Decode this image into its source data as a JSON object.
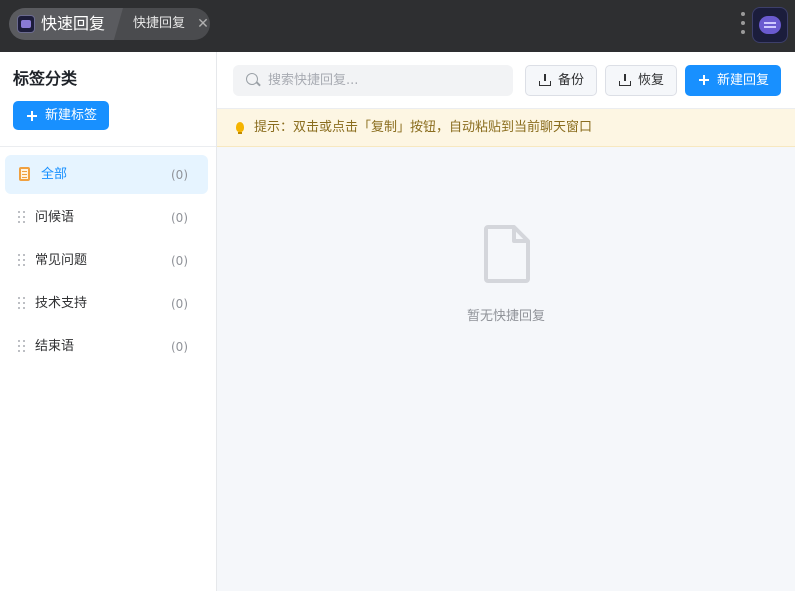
{
  "titlebar": {
    "app_name": "快速回复",
    "tab_label": "快捷回复",
    "tab_close_icon": "close-icon",
    "menu_icon": "more-vertical-icon",
    "avatar_icon": "chat-bubble-icon"
  },
  "sidebar": {
    "title": "标签分类",
    "new_tag_label": "新建标签",
    "categories": [
      {
        "label": "全部",
        "count": "(0)",
        "icon": "clipboard-icon",
        "active": true
      },
      {
        "label": "问候语",
        "count": "(0)",
        "icon": "drag-handle-icon"
      },
      {
        "label": "常见问题",
        "count": "(0)",
        "icon": "drag-handle-icon"
      },
      {
        "label": "技术支持",
        "count": "(0)",
        "icon": "drag-handle-icon"
      },
      {
        "label": "结束语",
        "count": "(0)",
        "icon": "drag-handle-icon"
      }
    ]
  },
  "toolbar": {
    "search_placeholder": "搜索快捷回复...",
    "search_value": "",
    "backup_label": "备份",
    "restore_label": "恢复",
    "new_reply_label": "新建回复"
  },
  "tip": {
    "text": "提示：双击或点击「复制」按钮，自动粘贴到当前聊天窗口",
    "icon": "lightbulb-icon"
  },
  "empty": {
    "text": "暂无快捷回复",
    "icon": "file-icon"
  },
  "colors": {
    "accent": "#1890ff",
    "titlebar_bg": "#2e2f31",
    "tip_bg": "#fdf6e3",
    "tip_text": "#8a6d1e"
  }
}
